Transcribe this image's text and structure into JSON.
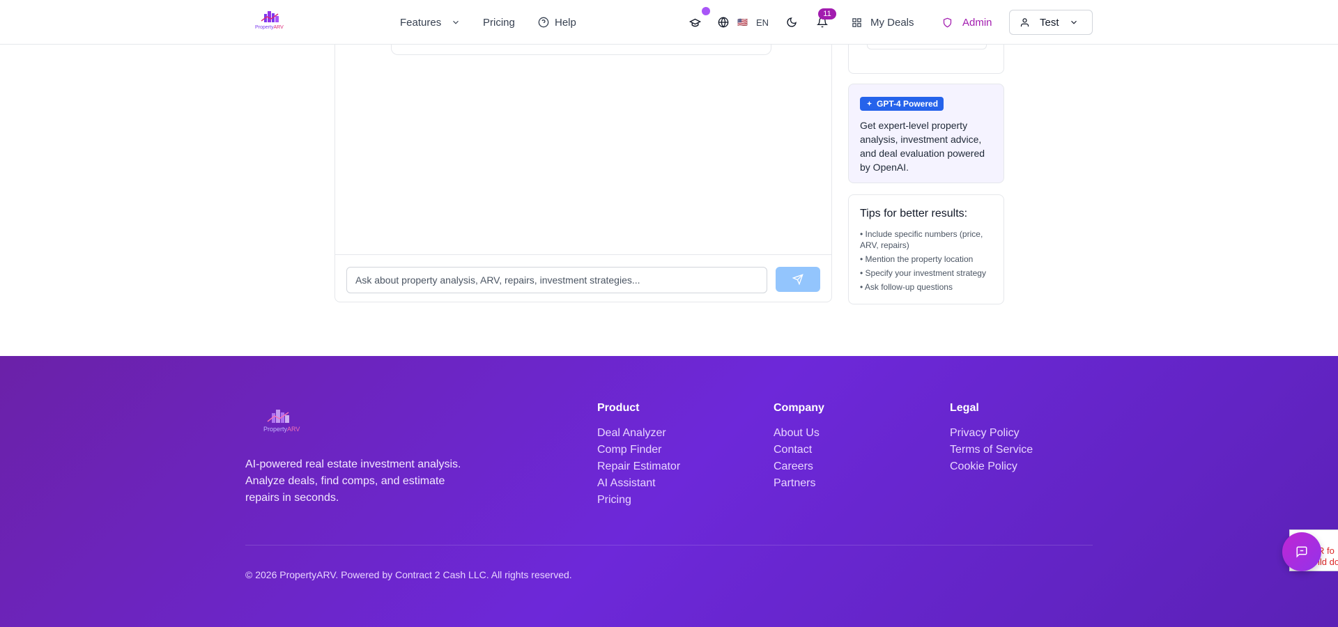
{
  "header": {
    "nav": {
      "features": "Features",
      "pricing": "Pricing",
      "help": "Help"
    },
    "language": {
      "flag": "🇺🇸",
      "code": "EN"
    },
    "notifications_count": "11",
    "my_deals": "My Deals",
    "admin": "Admin",
    "user_name": "Test"
  },
  "chat": {
    "input_placeholder": "Ask about property analysis, ARV, repairs, investment strategies..."
  },
  "gpt_card": {
    "badge": "GPT-4 Powered",
    "text": "Get expert-level property analysis, investment advice, and deal evaluation powered by OpenAI."
  },
  "tips": {
    "title": "Tips for better results:",
    "items": [
      "• Include specific numbers (price, ARV, repairs)",
      "• Mention the property location",
      "• Specify your investment strategy",
      "• Ask follow-up questions"
    ]
  },
  "footer": {
    "description": "AI-powered real estate investment analysis. Analyze deals, find comps, and estimate repairs in seconds.",
    "columns": [
      {
        "title": "Product",
        "links": [
          "Deal Analyzer",
          "Comp Finder",
          "Repair Estimator",
          "AI Assistant",
          "Pricing"
        ]
      },
      {
        "title": "Company",
        "links": [
          "About Us",
          "Contact",
          "Careers",
          "Partners"
        ]
      },
      {
        "title": "Legal",
        "links": [
          "Privacy Policy",
          "Terms of Service",
          "Cookie Policy"
        ]
      }
    ],
    "copyright": "© 2026 PropertyARV. Powered by Contract 2 Cash LLC. All rights reserved."
  },
  "side_widget": {
    "line1": "R fo",
    "line2": "ild do"
  },
  "logo_text": "PropertyARV",
  "colors": {
    "accent": "#a21caf",
    "footer_bg": "#6d28d9",
    "send_button": "#93c5fd",
    "gpt_badge": "#2563eb"
  }
}
